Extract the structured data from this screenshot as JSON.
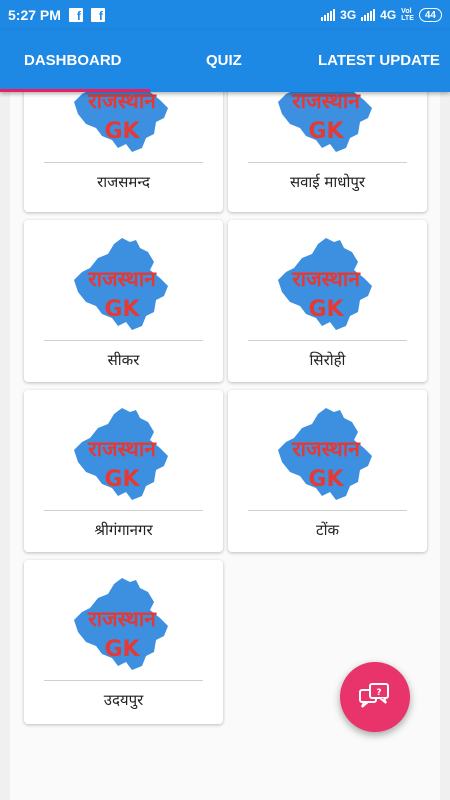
{
  "status_bar": {
    "time": "5:27 PM",
    "network_3g": "3G",
    "network_4g": "4G",
    "volte_top": "Vol",
    "volte_bottom": "LTE",
    "battery": "44"
  },
  "tabs": [
    {
      "label": "DASHBOARD",
      "selected": true
    },
    {
      "label": "QUIZ",
      "selected": false
    },
    {
      "label": "LATEST UPDATE",
      "selected": false
    }
  ],
  "logo": {
    "line1": "राजस्थान",
    "line2": "GK"
  },
  "cards": [
    {
      "label": "राजसमन्द"
    },
    {
      "label": "सवाई माधोपुर"
    },
    {
      "label": "सीकर"
    },
    {
      "label": "सिरोही"
    },
    {
      "label": "श्रीगंगानगर"
    },
    {
      "label": "टोंक"
    },
    {
      "label": "उदयपुर"
    }
  ],
  "colors": {
    "primary": "#1e88e5",
    "accent": "#e91e63",
    "fab": "#e8336b",
    "logo_text": "#e53935",
    "map_blue": "#3d8fe0"
  },
  "fab": {
    "icon": "question-chat-icon"
  }
}
